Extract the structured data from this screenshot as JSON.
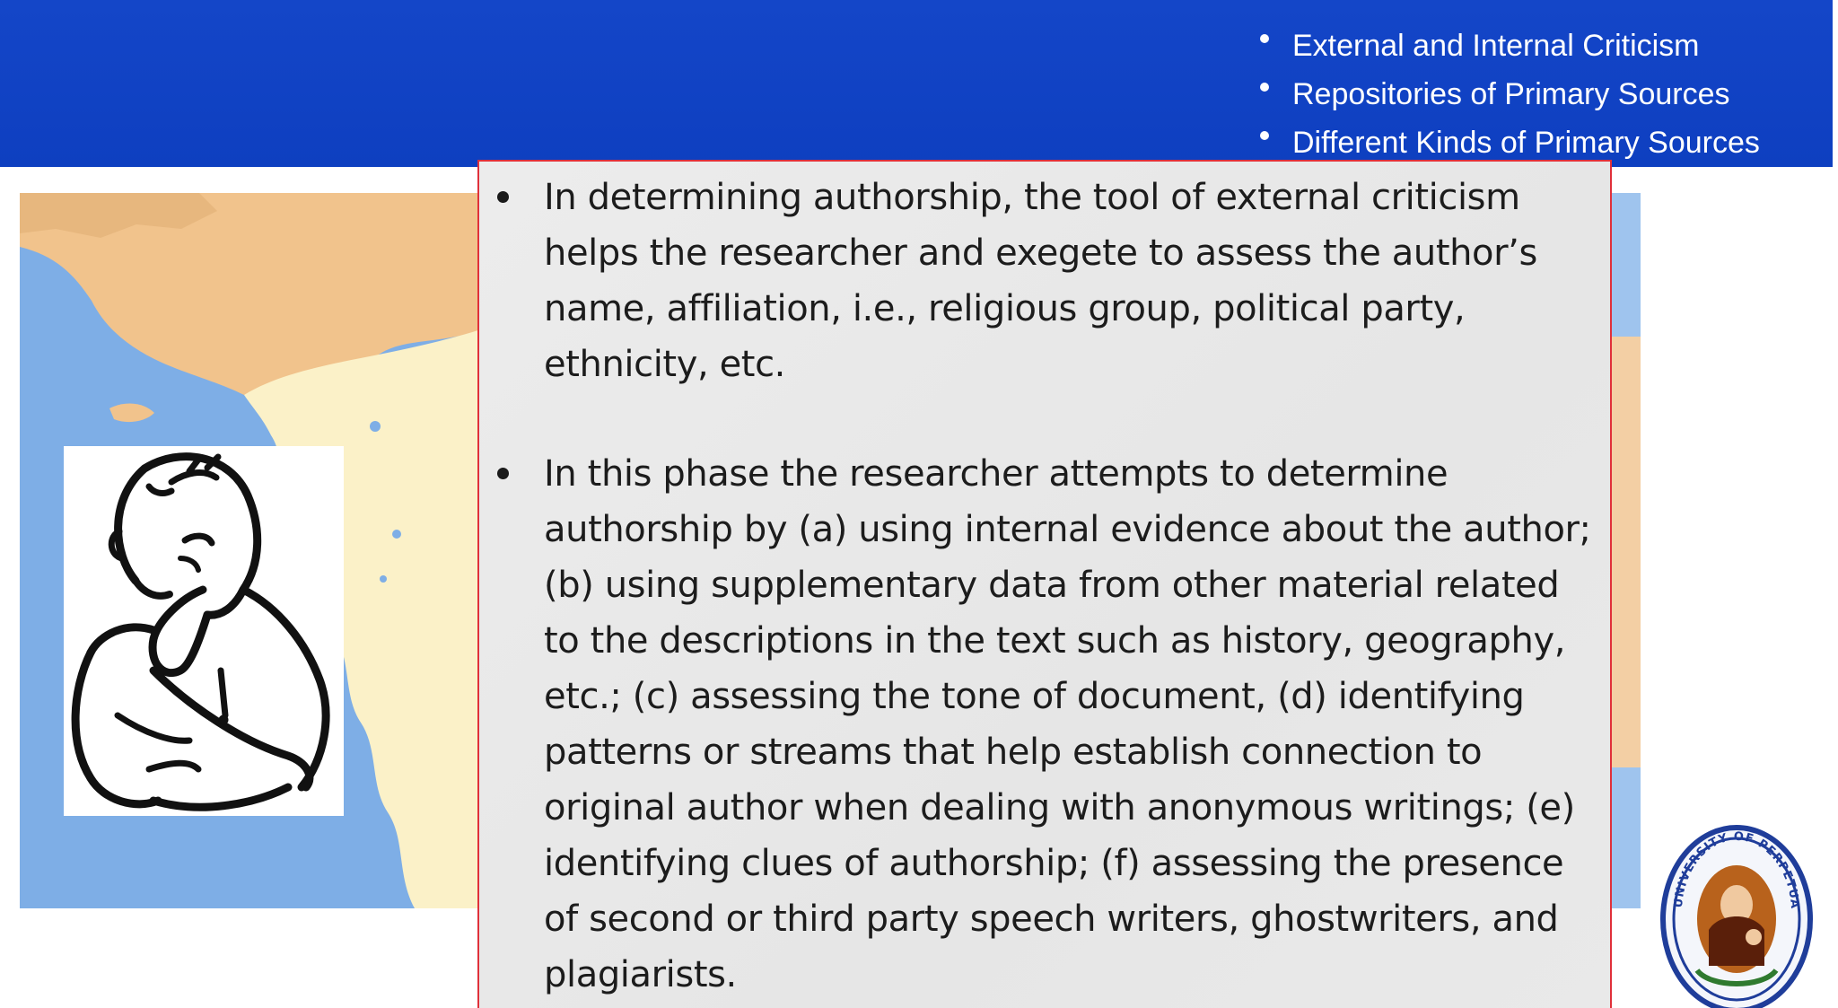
{
  "header": {
    "topics": [
      "External and Internal Criticism",
      "Repositories of Primary Sources",
      "Different Kinds of Primary Sources"
    ]
  },
  "content": {
    "paragraphs": [
      "In determining authorship, the tool of external criticism helps the researcher and exegete to assess the author’s name, affiliation, i.e., religious group, political party, ethnicity, etc.",
      "In this phase the researcher attempts to determine authorship by (a) using internal evidence about the author; (b) using supplementary data from other material related to the descriptions in the text such as history, geography, etc.; (c) assessing the tone of document, (d) identifying patterns or streams that help establish connection to original author when dealing with anonymous writings; (e) identifying clues of authorship; (f) assessing the presence of second or third party speech writers, ghostwriters, and plagiarists."
    ]
  },
  "seal": {
    "text": "UNIVERSITY OF PERPETUAL HELP SYSTEM"
  },
  "icons": {
    "thinker": "thinking-man-illustration",
    "map": "mediterranean-map",
    "seal": "university-seal"
  },
  "colors": {
    "header_blue": "#1446c8",
    "content_border": "#e0303a",
    "content_bg": "#e8e8e8",
    "map_sea": "#7eaee6",
    "map_land": "#f1c38c",
    "map_land_light": "#fbf1c8"
  }
}
